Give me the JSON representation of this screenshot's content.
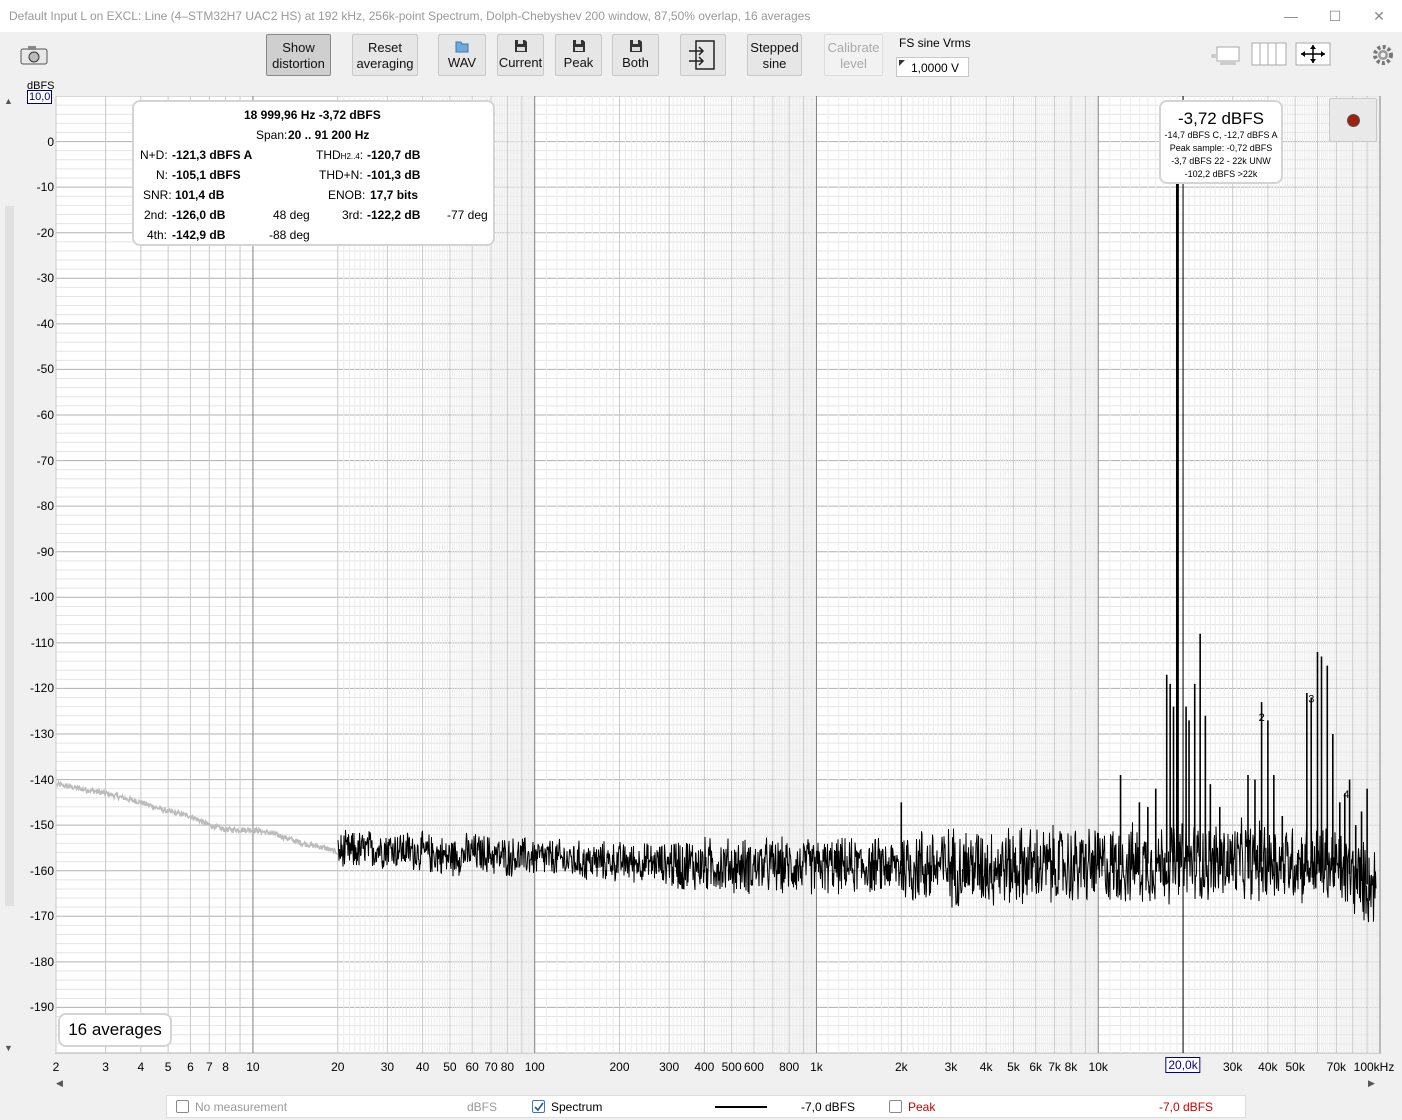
{
  "window": {
    "title": "Default Input L on EXCL: Line (4–STM32H7 UAC2 HS) at 192 kHz, 256k-point Spectrum, Dolph-Chebyshev 200 window, 87,50% overlap, 16 averages",
    "minimize": "—",
    "maximize": "☐",
    "close": "✕"
  },
  "toolbar": {
    "show_distortion": [
      "Show",
      "distortion"
    ],
    "reset_averaging": [
      "Reset",
      "averaging"
    ],
    "wav": "WAV",
    "current": "Current",
    "peak": "Peak",
    "both": "Both",
    "stepped_sine": [
      "Stepped",
      "sine"
    ],
    "calibrate_level": [
      "Calibrate",
      "level"
    ],
    "fs_sine_label": "FS sine Vrms",
    "fs_sine_value": "1,0000 V"
  },
  "axes": {
    "y_unit": "dBFS",
    "y_top_value": "10,0",
    "x_cursor_value": "20,0k",
    "y_ticks": [
      0,
      -10,
      -20,
      -30,
      -40,
      -50,
      -60,
      -70,
      -80,
      -90,
      -100,
      -110,
      -120,
      -130,
      -140,
      -150,
      -160,
      -170,
      -180,
      -190
    ],
    "x_ticks": [
      {
        "f": 2,
        "label": "2"
      },
      {
        "f": 3,
        "label": "3"
      },
      {
        "f": 4,
        "label": "4"
      },
      {
        "f": 5,
        "label": "5"
      },
      {
        "f": 6,
        "label": "6"
      },
      {
        "f": 7,
        "label": "7"
      },
      {
        "f": 8,
        "label": "8"
      },
      {
        "f": 10,
        "label": "10"
      },
      {
        "f": 20,
        "label": "20"
      },
      {
        "f": 30,
        "label": "30"
      },
      {
        "f": 40,
        "label": "40"
      },
      {
        "f": 50,
        "label": "50"
      },
      {
        "f": 60,
        "label": "60"
      },
      {
        "f": 70,
        "label": "70"
      },
      {
        "f": 80,
        "label": "80"
      },
      {
        "f": 100,
        "label": "100"
      },
      {
        "f": 200,
        "label": "200"
      },
      {
        "f": 300,
        "label": "300"
      },
      {
        "f": 400,
        "label": "400"
      },
      {
        "f": 500,
        "label": "500"
      },
      {
        "f": 600,
        "label": "600"
      },
      {
        "f": 800,
        "label": "800"
      },
      {
        "f": 1000,
        "label": "1k"
      },
      {
        "f": 2000,
        "label": "2k"
      },
      {
        "f": 3000,
        "label": "3k"
      },
      {
        "f": 4000,
        "label": "4k"
      },
      {
        "f": 5000,
        "label": "5k"
      },
      {
        "f": 6000,
        "label": "6k"
      },
      {
        "f": 7000,
        "label": "7k"
      },
      {
        "f": 8000,
        "label": "8k"
      },
      {
        "f": 10000,
        "label": "10k"
      },
      {
        "f": 30000,
        "label": "30k"
      },
      {
        "f": 40000,
        "label": "40k"
      },
      {
        "f": 50000,
        "label": "50k"
      },
      {
        "f": 70000,
        "label": "70k"
      },
      {
        "f": 100000,
        "label": "100kHz"
      }
    ]
  },
  "info": {
    "freq_level": "18 999,96 Hz  -3,72 dBFS",
    "span_label": "Span:",
    "span_value": "20 .. 91 200 Hz",
    "nd_label": "N+D:",
    "nd_value": "-121,3 dBFS A",
    "thd_label": "THD",
    "thd_sub": "H2..4",
    "thd_colon": ":",
    "thd_value": "-120,7 dB",
    "n_label": "N:",
    "n_value": "-105,1 dBFS",
    "thdn_label": "THD+N:",
    "thdn_value": "-101,3 dB",
    "snr_label": "SNR:",
    "snr_value": "101,4 dB",
    "enob_label": "ENOB:",
    "enob_value": "17,7 bits",
    "h2_label": "2nd:",
    "h2_value": "-126,0 dB",
    "h2_phase": "48 deg",
    "h3_label": "3rd:",
    "h3_value": "-122,2 dB",
    "h3_phase": "-77 deg",
    "h4_label": "4th:",
    "h4_value": "-142,9 dB",
    "h4_phase": "-88 deg"
  },
  "peak_box": {
    "main": "-3,72 dBFS",
    "lines": [
      "-14,7 dBFS C, -12,7 dBFS A",
      "Peak sample: -0,72 dBFS",
      "-3,7 dBFS 22 - 22k UNW",
      "-102,2 dBFS >22k"
    ]
  },
  "averages_label": "16 averages",
  "harmonic_markers": [
    {
      "label": "2",
      "f": 38000,
      "db": -126
    },
    {
      "label": "3",
      "f": 57000,
      "db": -122
    },
    {
      "label": "4",
      "f": 76000,
      "db": -143
    }
  ],
  "statusbar": {
    "no_measurement": "No measurement",
    "no_measurement_unit": "dBFS",
    "spectrum": "Spectrum",
    "spectrum_value": "-7,0 dBFS",
    "peak": "Peak",
    "peak_value": "-7,0 dBFS"
  },
  "colors": {
    "trace": "#000000",
    "trace_low": "#bbbbbb",
    "peak": "#cc0000",
    "cursor_label": "#00008b"
  },
  "chart_data": {
    "type": "line",
    "xlabel": "",
    "ylabel": "dBFS",
    "x_scale": "log",
    "xlim": [
      2,
      100000
    ],
    "ylim": [
      -200,
      10
    ],
    "grid": true,
    "cursor_x": 20000,
    "series": [
      {
        "name": "Spectrum",
        "x": [
          2,
          3,
          4,
          5,
          6,
          7,
          8,
          10,
          12,
          15,
          18,
          20,
          30,
          40,
          50,
          60,
          80,
          100,
          150,
          200,
          500,
          1000,
          2000,
          5000,
          10000,
          20000,
          50000,
          70000,
          90000
        ],
        "values": [
          -141,
          -143,
          -145,
          -147,
          -148,
          -150,
          -151,
          -151,
          -152,
          -154,
          -155,
          -156,
          -155,
          -156,
          -157,
          -156,
          -157,
          -157,
          -158,
          -158,
          -159,
          -159,
          -159,
          -159,
          -159,
          -158,
          -158,
          -159,
          -163
        ]
      }
    ],
    "peaks": [
      {
        "f": 19000,
        "db": -3.72
      },
      {
        "f": 19200,
        "db": -3.72
      },
      {
        "f": 2000,
        "db": -145
      },
      {
        "f": 12000,
        "db": -139
      },
      {
        "f": 14000,
        "db": -145
      },
      {
        "f": 15000,
        "db": -146
      },
      {
        "f": 16000,
        "db": -142
      },
      {
        "f": 17500,
        "db": -117
      },
      {
        "f": 18000,
        "db": -119
      },
      {
        "f": 18500,
        "db": -124
      },
      {
        "f": 20500,
        "db": -124
      },
      {
        "f": 21000,
        "db": -127
      },
      {
        "f": 22000,
        "db": -119
      },
      {
        "f": 23000,
        "db": -108
      },
      {
        "f": 24000,
        "db": -126
      },
      {
        "f": 25000,
        "db": -141
      },
      {
        "f": 27000,
        "db": -146
      },
      {
        "f": 34000,
        "db": -139
      },
      {
        "f": 36000,
        "db": -140
      },
      {
        "f": 38000,
        "db": -123
      },
      {
        "f": 40000,
        "db": -127
      },
      {
        "f": 42000,
        "db": -139
      },
      {
        "f": 45000,
        "db": -148
      },
      {
        "f": 55000,
        "db": -121
      },
      {
        "f": 57000,
        "db": -122
      },
      {
        "f": 60000,
        "db": -112
      },
      {
        "f": 62000,
        "db": -113
      },
      {
        "f": 65000,
        "db": -115
      },
      {
        "f": 68000,
        "db": -130
      },
      {
        "f": 72000,
        "db": -145
      },
      {
        "f": 75000,
        "db": -143
      },
      {
        "f": 78000,
        "db": -140
      },
      {
        "f": 82000,
        "db": -150
      },
      {
        "f": 86000,
        "db": -147
      },
      {
        "f": 90000,
        "db": -142
      }
    ]
  }
}
